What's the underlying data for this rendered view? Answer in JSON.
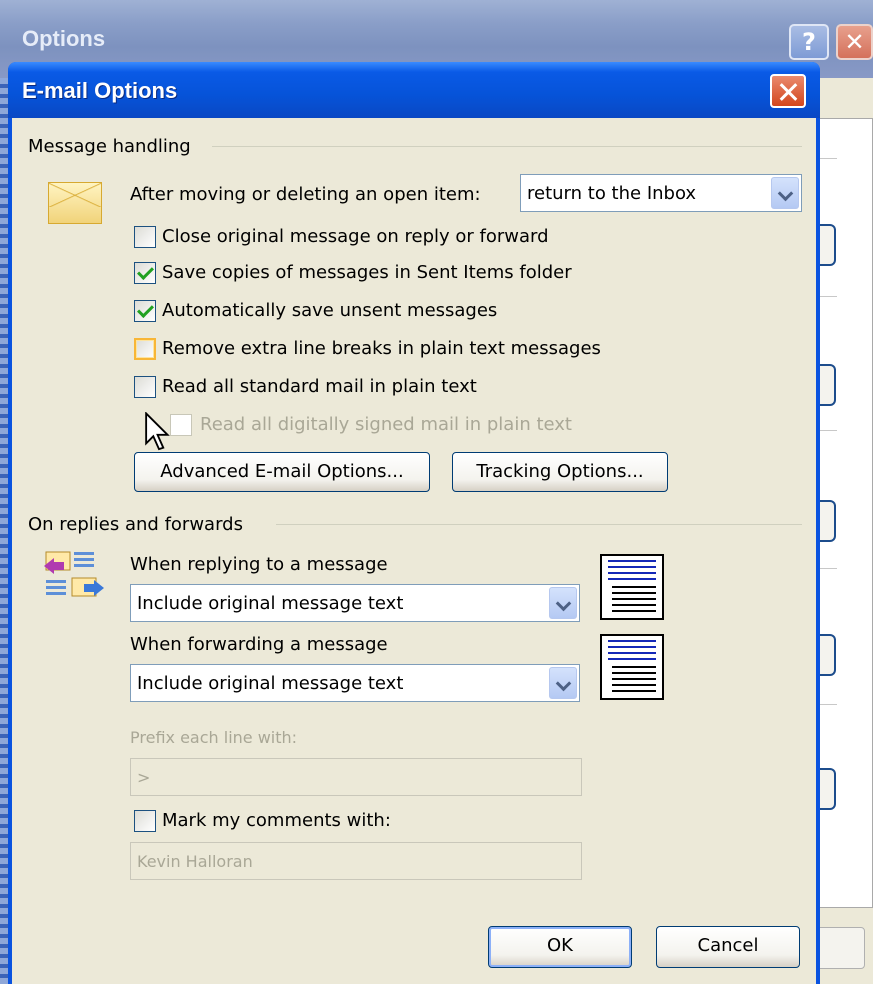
{
  "background_window": {
    "title": "Options",
    "help_label": "?",
    "close_label": "✕"
  },
  "dialog": {
    "title": "E-mail Options",
    "message_handling": {
      "group_label": "Message handling",
      "after_moving_label": "After moving or deleting an open item:",
      "after_moving_value": "return to the Inbox",
      "checkboxes": [
        {
          "label": "Close original message on reply or forward",
          "checked": false
        },
        {
          "label": "Save copies of messages in Sent Items folder",
          "checked": true
        },
        {
          "label": "Automatically save unsent messages",
          "checked": true
        },
        {
          "label": "Remove extra line breaks in plain text messages",
          "checked": false
        },
        {
          "label": "Read all standard mail in plain text",
          "checked": false
        },
        {
          "label": "Read all digitally signed mail in plain text",
          "checked": false,
          "disabled": true
        }
      ],
      "advanced_button": "Advanced E-mail Options...",
      "tracking_button": "Tracking Options..."
    },
    "replies_forwards": {
      "group_label": "On replies and forwards",
      "replying_label": "When replying to a message",
      "replying_value": "Include original message text",
      "forwarding_label": "When forwarding a message",
      "forwarding_value": "Include original message text",
      "prefix_label": "Prefix each line with:",
      "prefix_value": ">",
      "mark_comments_label": "Mark my comments with:",
      "mark_comments_checked": false,
      "mark_comments_value": "Kevin Halloran"
    },
    "ok_button": "OK",
    "cancel_button": "Cancel"
  },
  "colors": {
    "titlebar": "#0653d8",
    "face": "#ece9d8",
    "check": "#21a121",
    "hover": "#f8b636"
  }
}
